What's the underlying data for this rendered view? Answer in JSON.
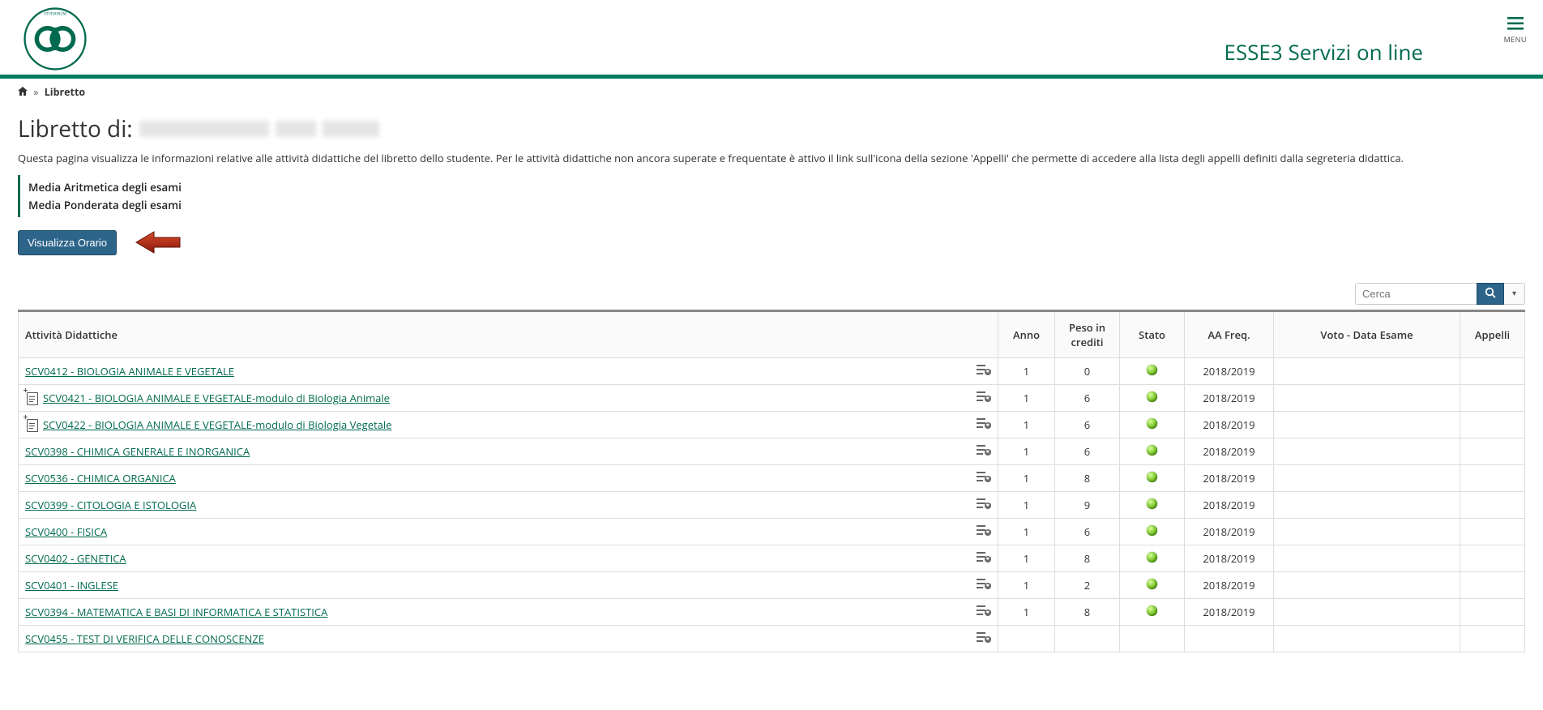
{
  "brand": {
    "title": "ESSE3 Servizi on line"
  },
  "menu": {
    "label": "MENU"
  },
  "breadcrumb": {
    "current": "Libretto",
    "sep": "»"
  },
  "page": {
    "title_prefix": "Libretto di:",
    "description": "Questa pagina visualizza le informazioni relative alle attività didattiche del libretto dello studente. Per le attività didattiche non ancora superate e frequentate è attivo il link sull'icona della sezione 'Appelli' che permette di accedere alla lista degli appelli definiti dalla segreteria didattica."
  },
  "media": {
    "arithmetic": "Media Aritmetica degli esami",
    "weighted": "Media Ponderata degli esami"
  },
  "buttons": {
    "visualizza_orario": "Visualizza Orario"
  },
  "search": {
    "placeholder": "Cerca"
  },
  "table": {
    "headers": {
      "attivita": "Attività Didattiche",
      "anno": "Anno",
      "peso": "Peso in crediti",
      "stato": "Stato",
      "aa_freq": "AA Freq.",
      "voto": "Voto - Data Esame",
      "appelli": "Appelli"
    },
    "rows": [
      {
        "label": "SCV0412 - BIOLOGIA ANIMALE E VEGETALE",
        "submodule": false,
        "anno": "1",
        "peso": "0",
        "aa": "2018/2019"
      },
      {
        "label": "SCV0421 - BIOLOGIA ANIMALE E VEGETALE-modulo di Biologia Animale",
        "submodule": true,
        "anno": "1",
        "peso": "6",
        "aa": "2018/2019"
      },
      {
        "label": "SCV0422 - BIOLOGIA ANIMALE E VEGETALE-modulo di Biologia Vegetale",
        "submodule": true,
        "anno": "1",
        "peso": "6",
        "aa": "2018/2019"
      },
      {
        "label": "SCV0398 - CHIMICA GENERALE E INORGANICA",
        "submodule": false,
        "anno": "1",
        "peso": "6",
        "aa": "2018/2019"
      },
      {
        "label": "SCV0536 - CHIMICA ORGANICA",
        "submodule": false,
        "anno": "1",
        "peso": "8",
        "aa": "2018/2019"
      },
      {
        "label": "SCV0399 - CITOLOGIA E ISTOLOGIA",
        "submodule": false,
        "anno": "1",
        "peso": "9",
        "aa": "2018/2019"
      },
      {
        "label": "SCV0400 - FISICA",
        "submodule": false,
        "anno": "1",
        "peso": "6",
        "aa": "2018/2019"
      },
      {
        "label": "SCV0402 - GENETICA",
        "submodule": false,
        "anno": "1",
        "peso": "8",
        "aa": "2018/2019"
      },
      {
        "label": "SCV0401 - INGLESE",
        "submodule": false,
        "anno": "1",
        "peso": "2",
        "aa": "2018/2019"
      },
      {
        "label": "SCV0394 - MATEMATICA E BASI DI INFORMATICA E STATISTICA",
        "submodule": false,
        "anno": "1",
        "peso": "8",
        "aa": "2018/2019"
      },
      {
        "label": "SCV0455 - TEST DI VERIFICA DELLE CONOSCENZE",
        "submodule": false,
        "anno": "",
        "peso": "",
        "aa": ""
      }
    ]
  }
}
